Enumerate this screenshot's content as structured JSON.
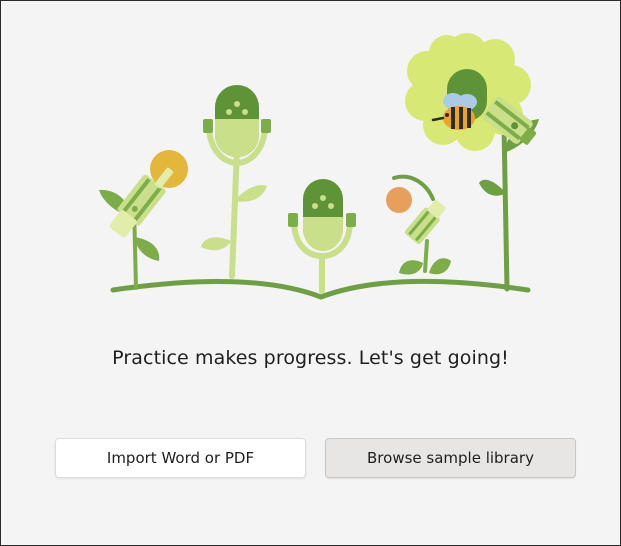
{
  "message": {
    "headline": "Practice makes progress. Let's get going!"
  },
  "actions": {
    "import_label": "Import Word or PDF",
    "browse_label": "Browse sample library"
  },
  "colors": {
    "background": "#f4f4f4",
    "leaf_light": "#c9df8a",
    "leaf_green": "#7dad49",
    "stem_dark": "#6f9f43",
    "mic_dark": "#5e9337",
    "mic_yellow": "#e3b73a",
    "mic_orange": "#e89f5c",
    "flower_yellow": "#d7e875",
    "bee_stripe": "#f1a41d"
  },
  "icons": {
    "illustration": "reading-garden-illustration",
    "bee": "bee-icon"
  }
}
